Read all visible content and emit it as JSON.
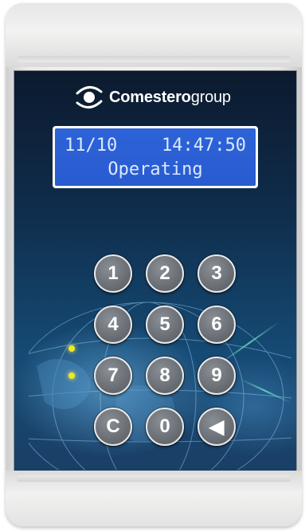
{
  "brand": {
    "name_bold": "Comestero",
    "name_light": "group",
    "logo_icon": "comestero-logo-icon"
  },
  "display": {
    "date": "11/10",
    "time": "14:47:50",
    "status": "Operating"
  },
  "keypad": {
    "keys": [
      {
        "label": "1",
        "name": "key-1"
      },
      {
        "label": "2",
        "name": "key-2"
      },
      {
        "label": "3",
        "name": "key-3"
      },
      {
        "label": "4",
        "name": "key-4"
      },
      {
        "label": "5",
        "name": "key-5"
      },
      {
        "label": "6",
        "name": "key-6"
      },
      {
        "label": "7",
        "name": "key-7"
      },
      {
        "label": "8",
        "name": "key-8"
      },
      {
        "label": "9",
        "name": "key-9"
      },
      {
        "label": "C",
        "name": "key-clear"
      },
      {
        "label": "0",
        "name": "key-0"
      },
      {
        "label": "◀",
        "name": "key-back"
      }
    ]
  },
  "colors": {
    "lcd": "#2d63d8",
    "lcd_text": "#dbe9ff",
    "led": "#f2e81c",
    "panel": "#0f2d4c"
  }
}
